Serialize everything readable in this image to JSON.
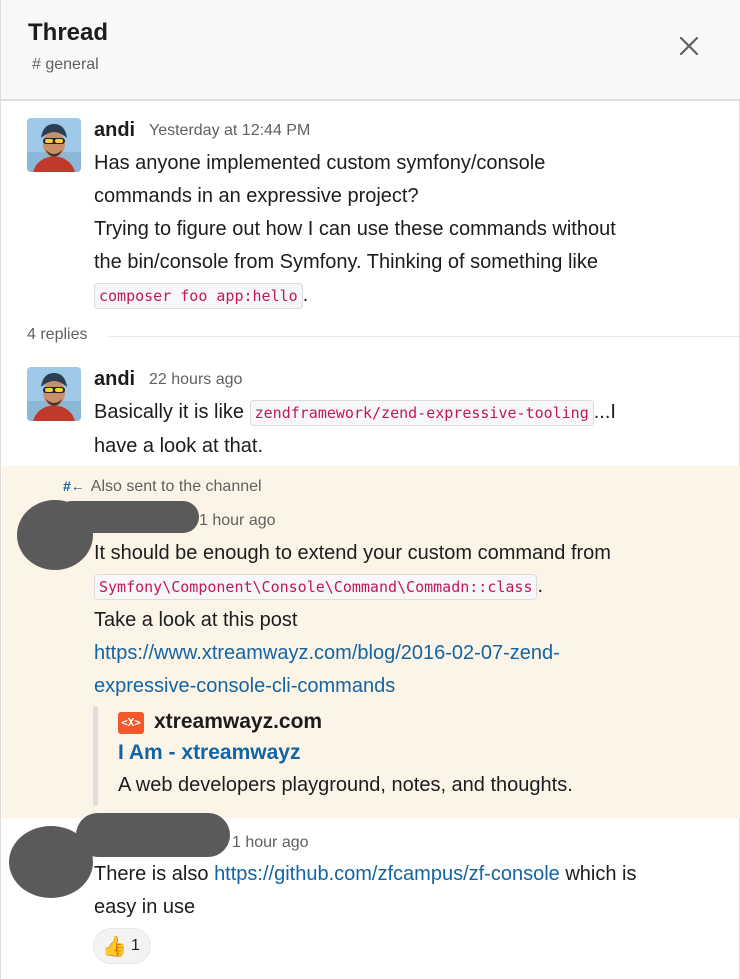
{
  "header": {
    "title": "Thread",
    "channel": "# general",
    "close_icon": "close-icon"
  },
  "parent_message": {
    "author": "andi",
    "timestamp": "Yesterday at 12:44 PM",
    "line1": "Has anyone implemented custom symfony/console",
    "line2": "commands in an expressive project?",
    "line3": "Trying to figure out how I can use these commands without",
    "line4": "the bin/console from Symfony. Thinking of something like",
    "code": "composer foo app:hello",
    "code_suffix": "."
  },
  "replies_label": "4 replies",
  "replies": [
    {
      "author": "andi",
      "timestamp": "22 hours ago",
      "pre": "Basically it is like ",
      "code": "zendframework/zend-expressive-tooling",
      "post": "...I",
      "line2": "have a look at that."
    },
    {
      "also_sent_icon": "#←",
      "also_sent": "Also sent to the channel",
      "timestamp": "1 hour ago",
      "line1": "It should be enough to extend your custom command from",
      "code": "Symfony\\Component\\Console\\Command\\Commadn::class",
      "code_suffix": ".",
      "line3": "Take a look at this post",
      "link_line1": "https://www.xtreamwayz.com/blog/2016-02-07-zend-",
      "link_line2": "expressive-console-cli-commands",
      "unfurl": {
        "logo_text": "<X>",
        "site": "xtreamwayz.com",
        "title": "I Am - xtreamwayz",
        "description": "A web developers playground, notes, and thoughts."
      }
    },
    {
      "timestamp": "1 hour ago",
      "pre": "There is also ",
      "link": "https://github.com/zfcampus/zf-console",
      "post": " which is",
      "line2": "easy in use",
      "reaction": {
        "emoji": "👍",
        "count": "1"
      }
    }
  ],
  "colors": {
    "link": "#1264a3",
    "code_text": "#c0185d",
    "highlight_bg": "#fcf5e7",
    "header_bg": "#f8f8f8"
  }
}
